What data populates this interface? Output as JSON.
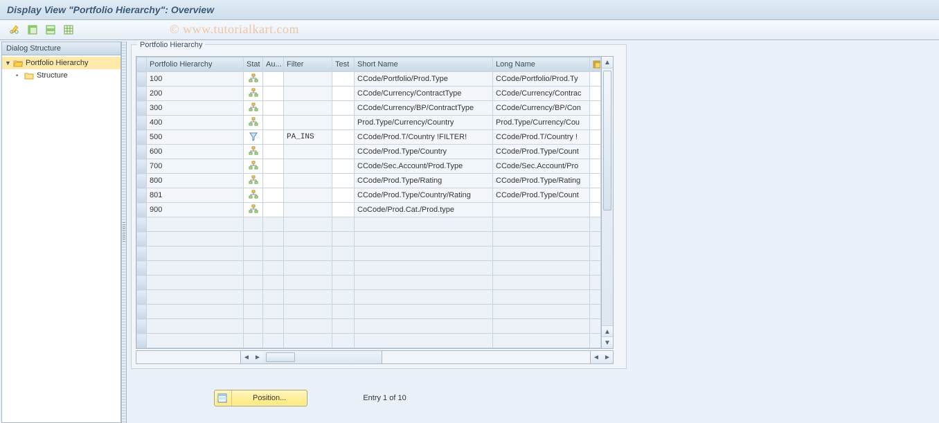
{
  "title": "Display View \"Portfolio Hierarchy\": Overview",
  "watermark": "© www.tutorialkart.com",
  "toolbar": {
    "edit_icon": "edit-icon",
    "select_all_icon": "select-all-icon",
    "select_block_icon": "select-block-icon",
    "deselect_icon": "deselect-icon"
  },
  "tree": {
    "header": "Dialog Structure",
    "items": [
      {
        "label": "Portfolio Hierarchy",
        "level": 0,
        "open": true,
        "selected": true,
        "expandable": true
      },
      {
        "label": "Structure",
        "level": 1,
        "open": false,
        "selected": false,
        "expandable": false
      }
    ]
  },
  "group": {
    "title": "Portfolio Hierarchy",
    "columns": {
      "ph": "Portfolio Hierarchy",
      "stat": "Stat",
      "au": "Au...",
      "filter": "Filter",
      "test": "Test",
      "short": "Short Name",
      "long": "Long Name"
    },
    "rows": [
      {
        "ph": "100",
        "stat": "hier",
        "au": "",
        "filter": "",
        "test": "",
        "short": "CCode/Portfolio/Prod.Type",
        "long": "CCode/Portfolio/Prod.Ty"
      },
      {
        "ph": "200",
        "stat": "hier",
        "au": "",
        "filter": "",
        "test": "",
        "short": "CCode/Currency/ContractType",
        "long": "CCode/Currency/Contrac"
      },
      {
        "ph": "300",
        "stat": "hier",
        "au": "",
        "filter": "",
        "test": "",
        "short": "CCode/Currency/BP/ContractType",
        "long": "CCode/Currency/BP/Con"
      },
      {
        "ph": "400",
        "stat": "hier",
        "au": "",
        "filter": "",
        "test": "",
        "short": "Prod.Type/Currency/Country",
        "long": "Prod.Type/Currency/Cou"
      },
      {
        "ph": "500",
        "stat": "filter",
        "au": "",
        "filter": "PA_INS",
        "test": "",
        "short": "CCode/Prod.T/Country !FILTER!",
        "long": "CCode/Prod.T/Country !"
      },
      {
        "ph": "600",
        "stat": "hier",
        "au": "",
        "filter": "",
        "test": "",
        "short": "CCode/Prod.Type/Country",
        "long": "CCode/Prod.Type/Count"
      },
      {
        "ph": "700",
        "stat": "hier",
        "au": "",
        "filter": "",
        "test": "",
        "short": "CCode/Sec.Account/Prod.Type",
        "long": "CCode/Sec.Account/Pro"
      },
      {
        "ph": "800",
        "stat": "hier",
        "au": "",
        "filter": "",
        "test": "",
        "short": "CCode/Prod.Type/Rating",
        "long": "CCode/Prod.Type/Rating"
      },
      {
        "ph": "801",
        "stat": "hier",
        "au": "",
        "filter": "",
        "test": "",
        "short": "CCode/Prod.Type/Country/Rating",
        "long": "CCode/Prod.Type/Count"
      },
      {
        "ph": "900",
        "stat": "hier",
        "au": "",
        "filter": "",
        "test": "",
        "short": "CoCode/Prod.Cat./Prod.type",
        "long": ""
      }
    ],
    "empty_rows": 9
  },
  "footer": {
    "position_label": "Position...",
    "entry_text": "Entry 1 of 10"
  }
}
